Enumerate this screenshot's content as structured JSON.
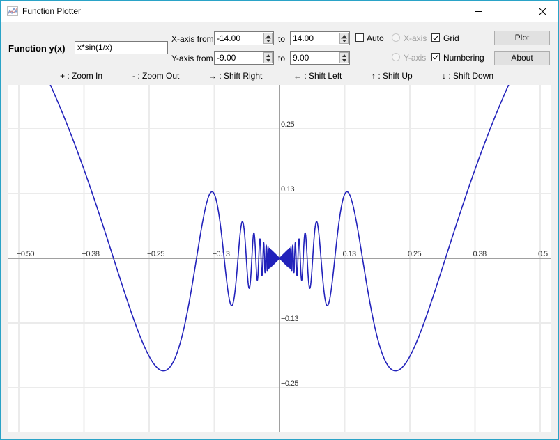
{
  "window": {
    "title": "Function Plotter",
    "icon": "chart-line-icon",
    "controls": {
      "minimize": "—",
      "maximize": "☐",
      "close": "✕"
    }
  },
  "form": {
    "function_label": "Function y(x)",
    "function_value": "x*sin(1/x)",
    "x_from_label": "X-axis from",
    "x_from_value": "-14.00",
    "x_to_label": "to",
    "x_to_value": "14.00",
    "y_from_label": "Y-axis from",
    "y_from_value": "-9.00",
    "y_to_label": "to",
    "y_to_value": "9.00",
    "auto_label": "Auto",
    "auto_checked": false,
    "xaxis_label": "X-axis",
    "yaxis_label": "Y-axis",
    "grid_label": "Grid",
    "grid_checked": true,
    "numbering_label": "Numbering",
    "numbering_checked": true,
    "plot_button": "Plot",
    "about_button": "About"
  },
  "hints": [
    {
      "key": "+",
      "text": "+ : Zoom In"
    },
    {
      "key": "-",
      "text": "- : Zoom Out"
    },
    {
      "key": "→",
      "text": "→ : Shift Right"
    },
    {
      "key": "←",
      "text": "← : Shift Left"
    },
    {
      "key": "↑",
      "text": "↑ : Shift Up"
    },
    {
      "key": "↓",
      "text": "↓ : Shift Down"
    }
  ],
  "chart_data": {
    "type": "line",
    "function": "x*sin(1/x)",
    "series": [
      {
        "name": "x*sin(1/x)",
        "color": "#2222bb"
      }
    ],
    "x_ticks": [
      -0.5,
      -0.375,
      -0.25,
      -0.125,
      0.125,
      0.25,
      0.375,
      0.5
    ],
    "x_tick_labels": [
      "−0.50",
      "−0.38",
      "−0.25",
      "−0.13",
      "0.13",
      "0.25",
      "0.38",
      "0.5"
    ],
    "y_ticks": [
      0.25,
      0.125,
      -0.125,
      -0.25
    ],
    "y_tick_labels": [
      "0.25",
      "0.13",
      "−0.13",
      "−0.25"
    ],
    "xlim": [
      -0.52,
      0.52
    ],
    "ylim": [
      -0.335,
      0.333
    ],
    "grid": true,
    "colors": {
      "curve": "#2222bb",
      "axis": "#a0a0a0",
      "grid": "#ebebeb"
    }
  }
}
